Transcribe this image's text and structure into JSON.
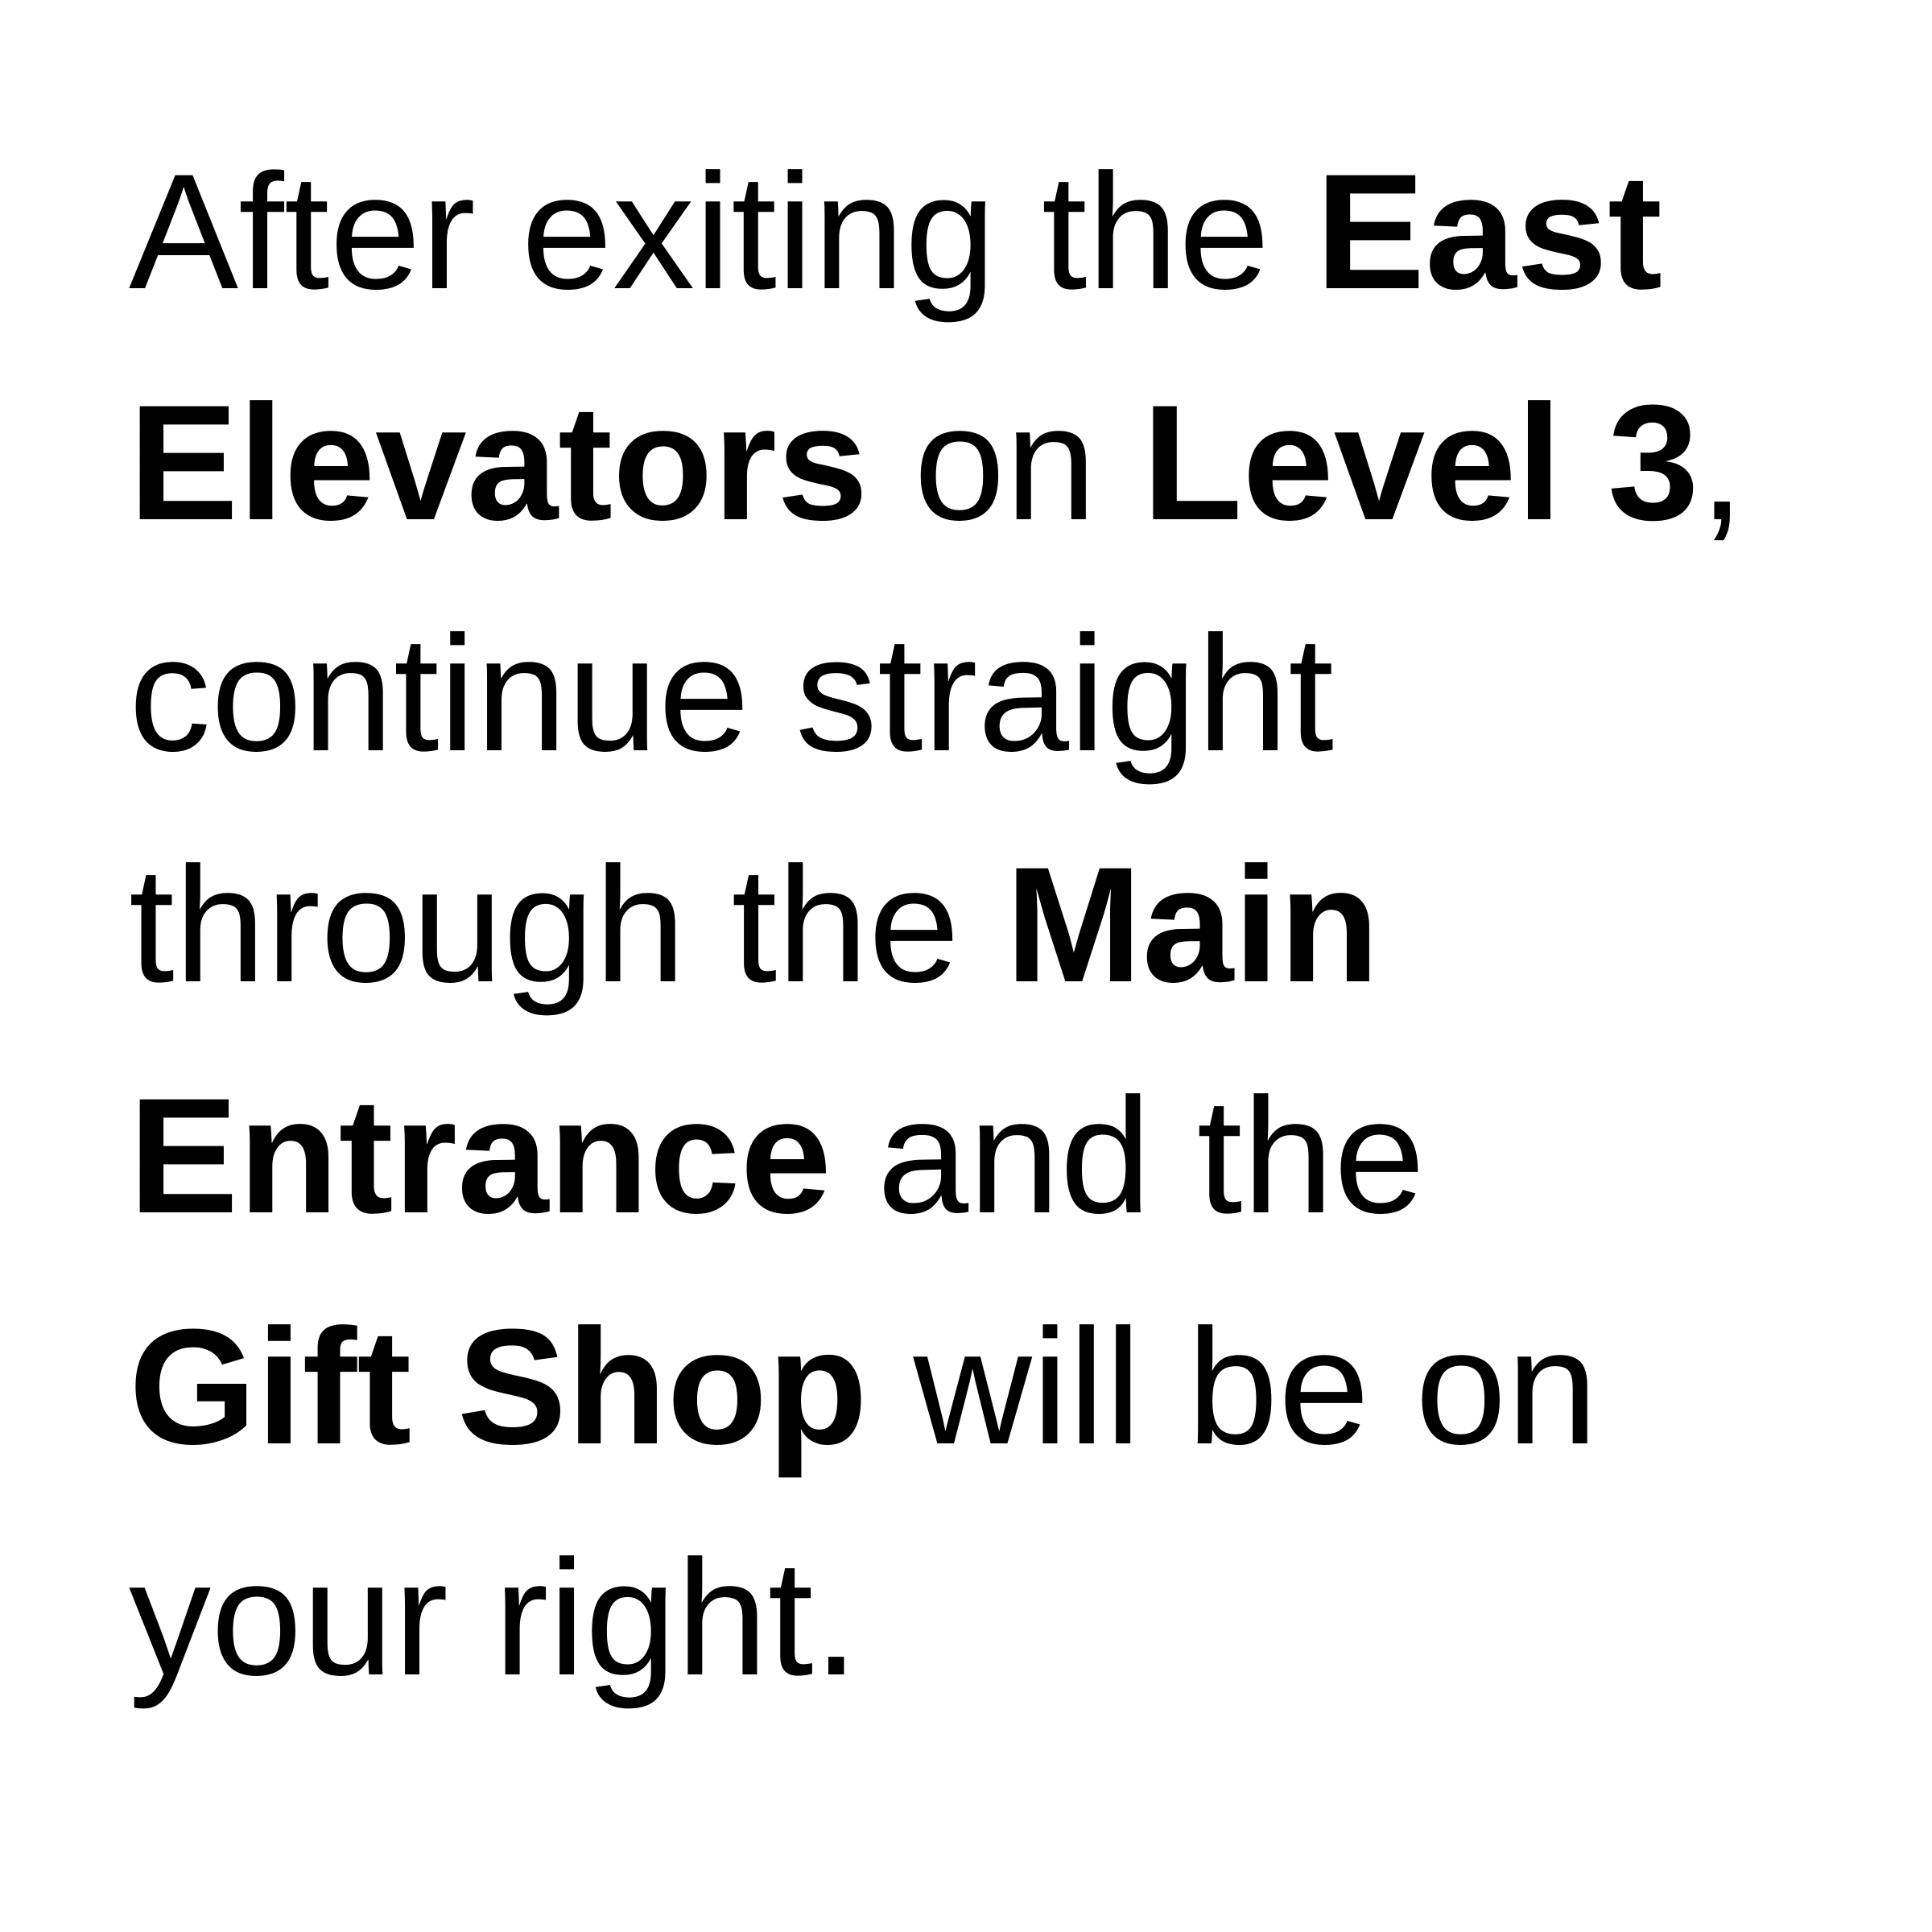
{
  "directions": {
    "line1": {
      "t1": "After exiting the ",
      "b1": "East"
    },
    "line2": {
      "b1": "Elevators",
      "t1": " on ",
      "b2": "Level 3",
      "t2": ","
    },
    "line3": {
      "t1": "continue straight"
    },
    "line4": {
      "t1": "through the ",
      "b1": "Main"
    },
    "line5": {
      "b1": "Entrance",
      "t1": " and the"
    },
    "line6": {
      "b1": "Gift Shop",
      "t1": " will be on"
    },
    "line7": {
      "t1": "your right."
    }
  }
}
